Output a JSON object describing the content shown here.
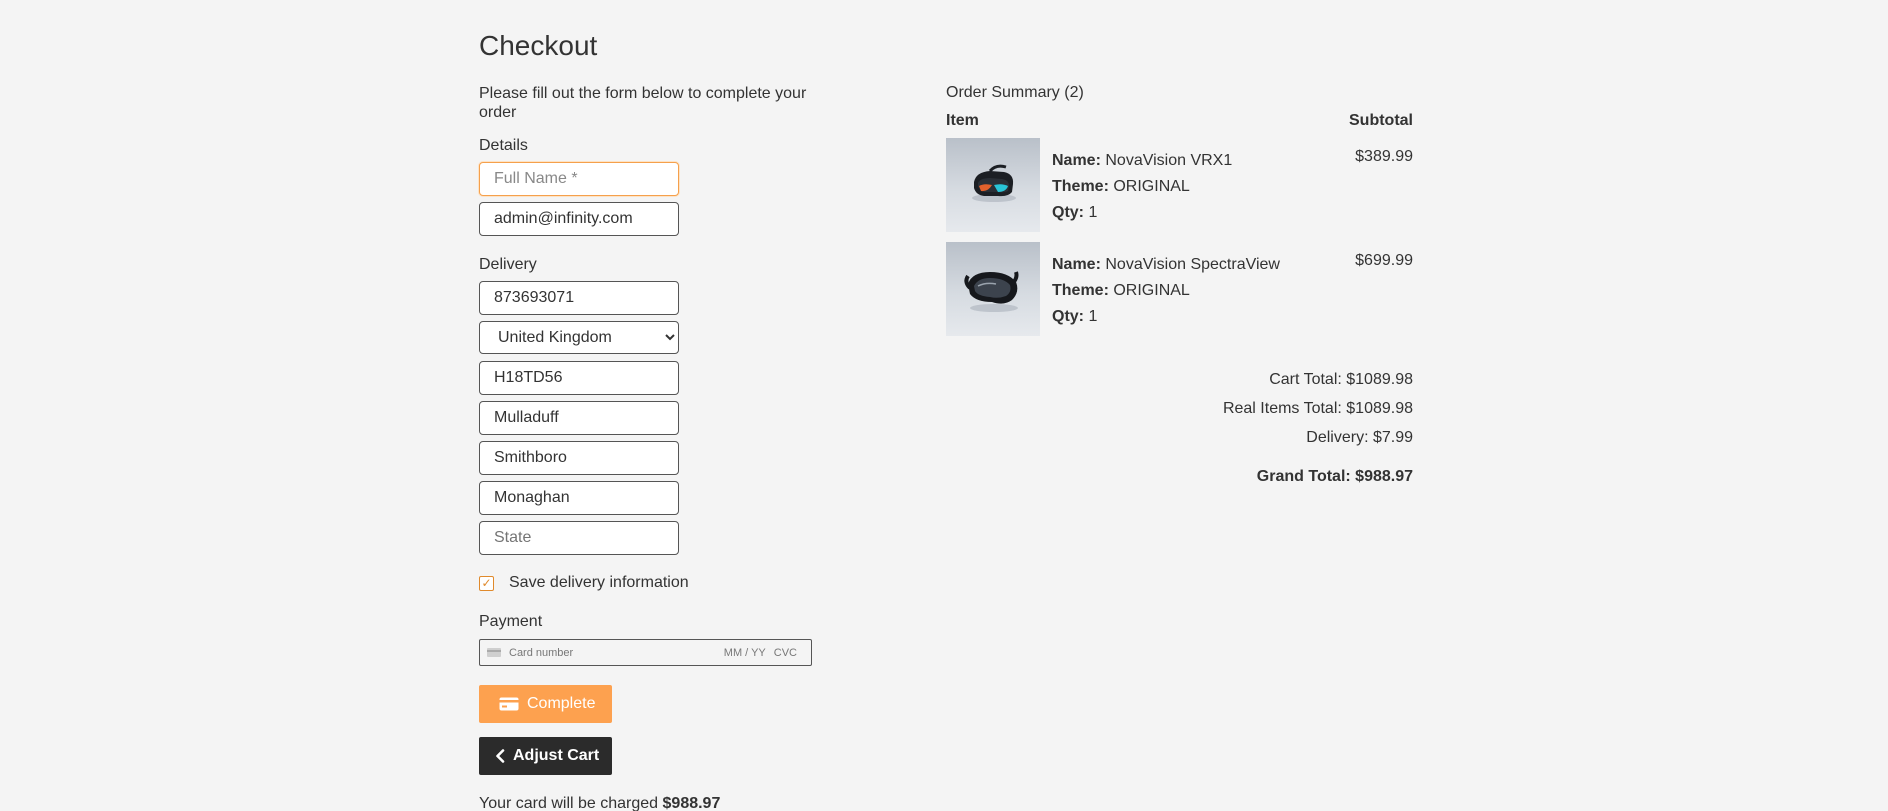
{
  "page": {
    "title": "Checkout"
  },
  "form": {
    "intro": "Please fill out the form below to complete your order",
    "details_label": "Details",
    "full_name_placeholder": "Full Name *",
    "email_value": "admin@infinity.com",
    "delivery_label": "Delivery",
    "phone_value": "873693071",
    "country_value": "United Kingdom",
    "postcode_value": "H18TD56",
    "address_line1_value": "Mulladuff",
    "address_line2_value": "Smithboro",
    "city_value": "Monaghan",
    "state_placeholder": "State",
    "save_delivery_label": "Save delivery information",
    "save_delivery_checked": true,
    "payment_label": "Payment",
    "card_number_placeholder": "Card number",
    "card_expiry_placeholder": "MM / YY",
    "card_cvc_placeholder": "CVC",
    "complete_button": "Complete",
    "adjust_cart_button": "Adjust Cart",
    "charge_text": "Your card will be charged ",
    "charge_amount": "$988.97"
  },
  "summary": {
    "heading": "Order Summary (2)",
    "col_item": "Item",
    "col_subtotal": "Subtotal",
    "name_key": "Name:",
    "theme_key": "Theme:",
    "qty_key": "Qty:",
    "items": [
      {
        "name": "NovaVision VRX1",
        "theme": "ORIGINAL",
        "qty": "1",
        "subtotal": "$389.99",
        "image": "vr-headset-image"
      },
      {
        "name": "NovaVision SpectraView",
        "theme": "ORIGINAL",
        "qty": "1",
        "subtotal": "$699.99",
        "image": "vr-goggles-image"
      }
    ],
    "cart_total": "Cart Total: $1089.98",
    "real_items_total": "Real Items Total: $1089.98",
    "delivery": "Delivery: $7.99",
    "grand_total": "Grand Total: $988.97"
  },
  "colors": {
    "accent": "#fda14f",
    "dark_button": "#2b2b2b",
    "background": "#f4f4f4"
  }
}
